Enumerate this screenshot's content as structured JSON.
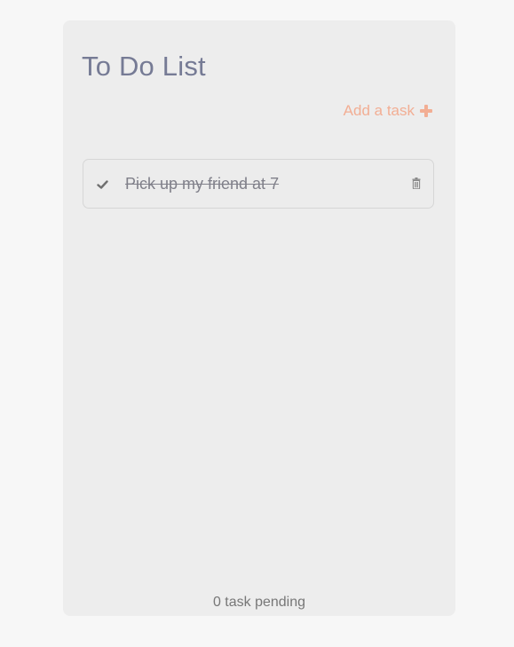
{
  "app": {
    "title": "To Do List",
    "add_task_label": "Add a task",
    "add_task_icon": "plus-icon"
  },
  "tasks": [
    {
      "text": "Pick up my friend at 7",
      "completed": true,
      "check_icon": "check-icon",
      "delete_icon": "trash-icon"
    }
  ],
  "footer": {
    "pending_text": "0 task pending"
  },
  "colors": {
    "page_bg": "#f7f7f7",
    "card_bg": "#ededed",
    "title": "#767b95",
    "accent": "#f2ae94",
    "task_text": "#80808a"
  }
}
